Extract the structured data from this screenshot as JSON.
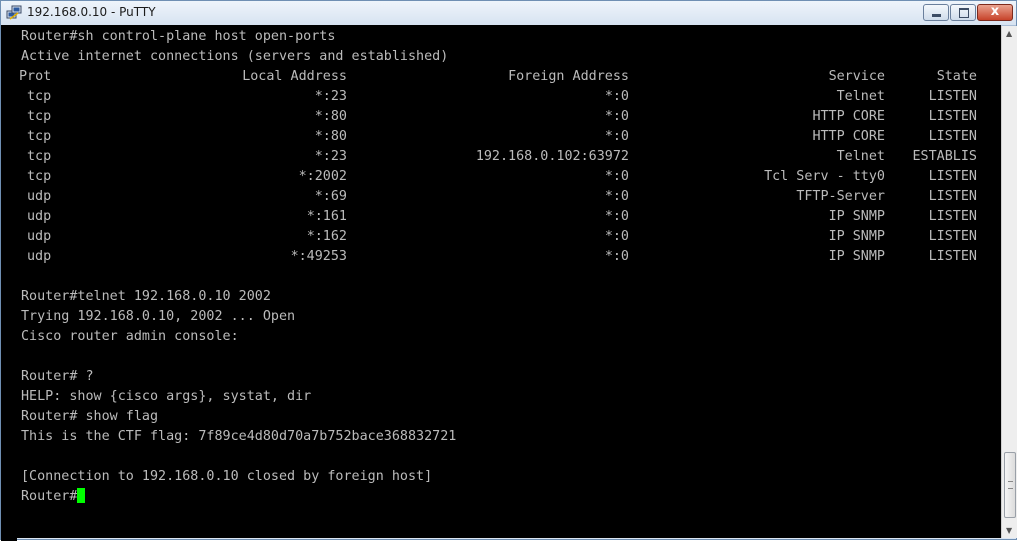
{
  "window": {
    "title": "192.168.0.10 - PuTTY",
    "close_glyph": "x"
  },
  "terminal": {
    "lines": [
      "Router#sh control-plane host open-ports",
      "Active internet connections (servers and established)"
    ],
    "table": {
      "headers": [
        "Prot",
        "Local Address",
        "Foreign Address",
        "Service",
        "State"
      ],
      "rows": [
        [
          "tcp",
          "*:23",
          "*:0",
          "Telnet",
          "LISTEN"
        ],
        [
          "tcp",
          "*:80",
          "*:0",
          "HTTP CORE",
          "LISTEN"
        ],
        [
          "tcp",
          "*:80",
          "*:0",
          "HTTP CORE",
          "LISTEN"
        ],
        [
          "tcp",
          "*:23",
          "192.168.0.102:63972",
          "Telnet",
          "ESTABLIS"
        ],
        [
          "tcp",
          "*:2002",
          "*:0",
          "Tcl Serv - tty0",
          "LISTEN"
        ],
        [
          "udp",
          "*:69",
          "*:0",
          "TFTP-Server",
          "LISTEN"
        ],
        [
          "udp",
          "*:161",
          "*:0",
          "IP SNMP",
          "LISTEN"
        ],
        [
          "udp",
          "*:162",
          "*:0",
          "IP SNMP",
          "LISTEN"
        ],
        [
          "udp",
          "*:49253",
          "*:0",
          "IP SNMP",
          "LISTEN"
        ]
      ]
    },
    "after": [
      "Router#telnet 192.168.0.10 2002",
      "Trying 192.168.0.10, 2002 ... Open",
      "Cisco router admin console:",
      "",
      "Router# ?",
      "HELP: show {cisco args}, systat, dir",
      "Router# show flag",
      "This is the CTF flag: 7f89ce4d80d70a7b752bace368832721",
      "",
      "[Connection to 192.168.0.10 closed by foreign host]"
    ],
    "prompt": "Router#"
  },
  "colors": {
    "terminal_bg": "#000000",
    "terminal_fg": "#bbbbbb",
    "cursor": "#00ff00"
  },
  "icons": {
    "app": "putty-icon",
    "minimize": "minimize-icon",
    "maximize": "maximize-icon",
    "close": "close-icon",
    "scroll_up": "scroll-up-arrow-icon",
    "scroll_down": "scroll-down-arrow-icon"
  }
}
